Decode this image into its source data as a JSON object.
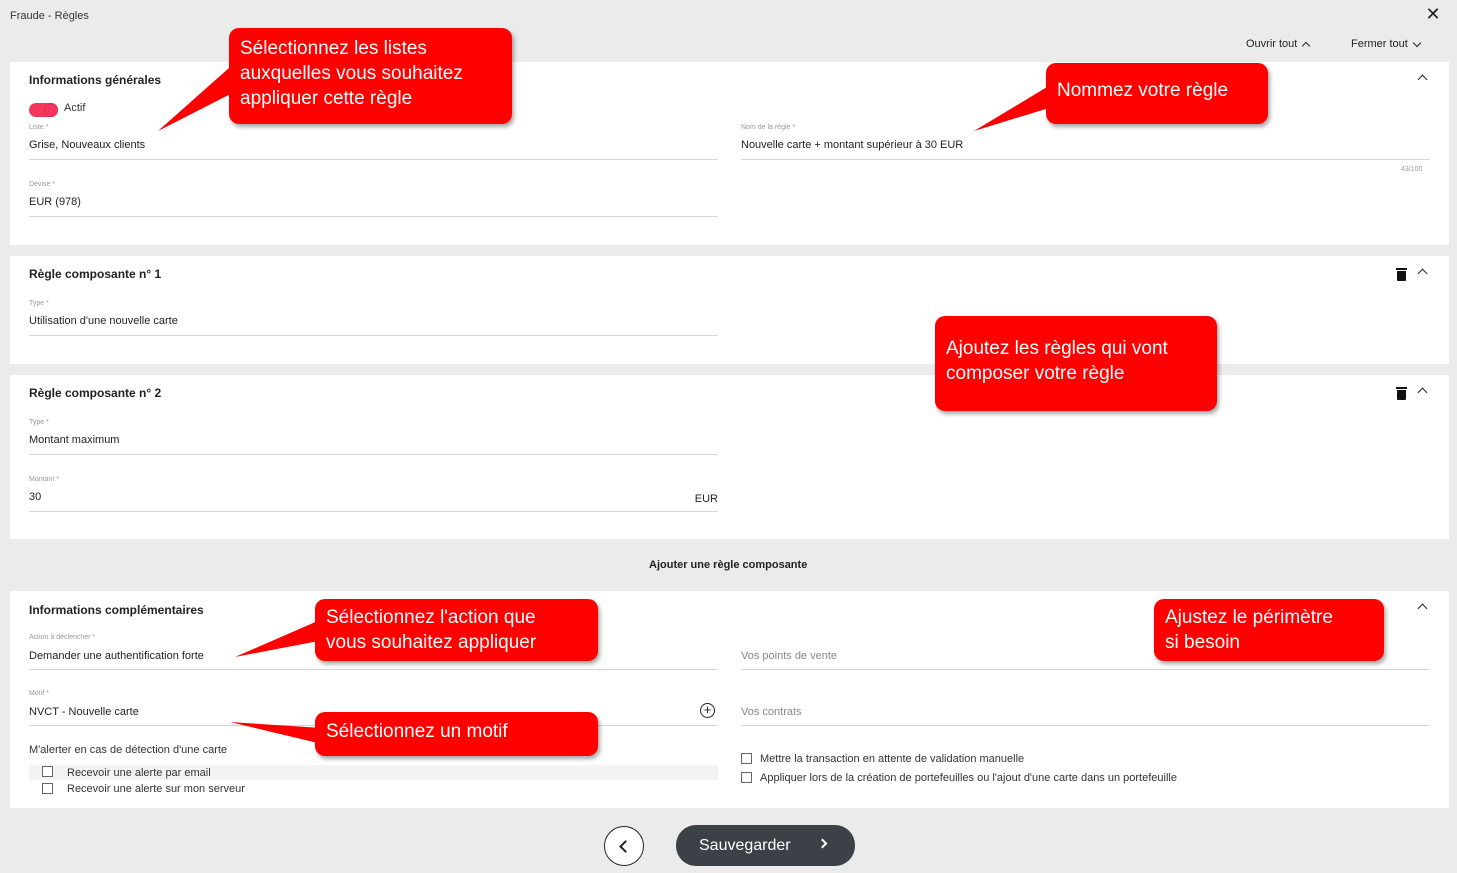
{
  "window": {
    "title": "Fraude - Règles"
  },
  "toolbar": {
    "open_all": "Ouvrir tout",
    "close_all": "Fermer tout"
  },
  "general": {
    "title": "Informations générales",
    "toggle_label": "Actif",
    "list": {
      "label": "Liste *",
      "value": "Grise, Nouveaux clients"
    },
    "rule_name": {
      "label": "Nom de la règle *",
      "value": "Nouvelle carte + montant supérieur à 30 EUR",
      "counter": "43/100"
    },
    "currency": {
      "label": "Devise *",
      "value": "EUR (978)"
    }
  },
  "rule1": {
    "title": "Règle composante n° 1",
    "type": {
      "label": "Type *",
      "value": "Utilisation d'une nouvelle carte"
    }
  },
  "rule2": {
    "title": "Règle composante n° 2",
    "type": {
      "label": "Type *",
      "value": "Montant maximum"
    },
    "amount": {
      "label": "Montant *",
      "value": "30",
      "suffix": "EUR"
    }
  },
  "add_rule": "Ajouter une règle composante",
  "extra": {
    "title": "Informations complémentaires",
    "action": {
      "label": "Action à déclencher *",
      "value": "Demander une authentification forte"
    },
    "motif": {
      "label": "Motif *",
      "value": "NVCT - Nouvelle carte"
    },
    "points_of_sale": {
      "placeholder": "Vos points de vente"
    },
    "contracts": {
      "placeholder": "Vos contrats"
    },
    "alert_title": "M'alerter en cas de détection d'une carte",
    "alert_email": "Recevoir une alerte par email",
    "alert_server": "Recevoir une alerte sur mon serveur",
    "hold_manual": "Mettre la transaction en attente de validation manuelle",
    "apply_wallet": "Appliquer lors de la création de portefeuilles ou l'ajout d'une carte dans un portefeuille"
  },
  "footer": {
    "save": "Sauvegarder"
  },
  "callouts": {
    "lists_l1": "Sélectionnez les listes",
    "lists_l2": "auxquelles vous souhaitez",
    "lists_l3": "appliquer cette règle",
    "name": "Nommez votre règle",
    "rules_l1": "Ajoutez les règles qui vont",
    "rules_l2": "composer votre règle",
    "action_l1": "Sélectionnez l'action que",
    "action_l2": "vous souhaitez appliquer",
    "perimeter_l1": "Ajustez le périmètre",
    "perimeter_l2": "si besoin",
    "motif": "Sélectionnez un motif"
  },
  "colors": {
    "accent": "#f5365c",
    "callout": "#ff0000",
    "save_button": "#3b4146"
  }
}
